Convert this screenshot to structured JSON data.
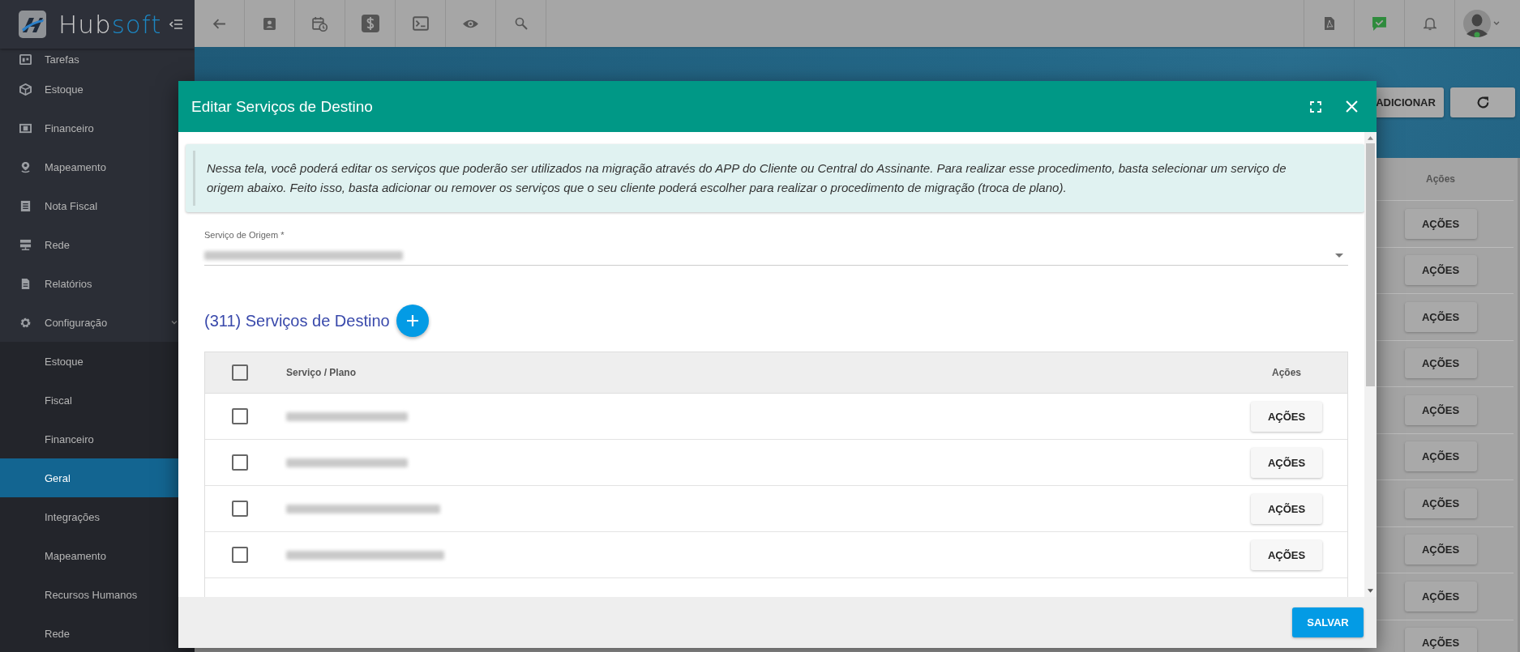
{
  "sidebar": {
    "brand": {
      "text": "Hub",
      "accent_text": "soft"
    },
    "items": [
      {
        "kind": "link",
        "label": "Tarefas",
        "selected": false
      },
      {
        "kind": "link",
        "label": "Estoque",
        "selected": false
      },
      {
        "kind": "link",
        "label": "Financeiro",
        "selected": false
      },
      {
        "kind": "link",
        "label": "Mapeamento",
        "selected": false
      },
      {
        "kind": "link",
        "label": "Nota Fiscal",
        "selected": false
      },
      {
        "kind": "link",
        "label": "Rede",
        "selected": false
      },
      {
        "kind": "link",
        "label": "Relatórios",
        "selected": false
      },
      {
        "kind": "group",
        "label": "Configuração",
        "selected": false,
        "expanded": true,
        "children": [
          {
            "label": "Estoque",
            "selected": false
          },
          {
            "label": "Fiscal",
            "selected": false
          },
          {
            "label": "Financeiro",
            "selected": false
          },
          {
            "label": "Geral",
            "selected": true
          },
          {
            "label": "Integrações",
            "selected": false
          },
          {
            "label": "Mapeamento",
            "selected": false
          },
          {
            "label": "Recursos Humanos",
            "selected": false
          },
          {
            "label": "Rede",
            "selected": false
          }
        ]
      }
    ]
  },
  "page": {
    "add_button": "ADICIONAR",
    "table": {
      "column": "Ações",
      "rows": [
        "AÇÕES",
        "AÇÕES",
        "AÇÕES",
        "AÇÕES",
        "AÇÕES",
        "AÇÕES",
        "AÇÕES",
        "AÇÕES",
        "AÇÕES",
        "AÇÕES"
      ]
    }
  },
  "modal": {
    "title": "Editar Serviços de Destino",
    "notice": "Nessa tela, você poderá editar os serviços que poderão ser utilizados na migração através do APP do Cliente ou Central do Assinante. Para realizar esse procedimento, basta selecionar um serviço de origem abaixo. Feito isso, basta adicionar ou remover os serviços que o seu cliente poderá escolher para realizar o procedimento de migração (troca de plano).",
    "origin_field": {
      "label": "Serviço de Origem *"
    },
    "destination": {
      "title": "(311) Serviços de Destino",
      "table": {
        "select_all": {
          "checked": false
        },
        "columns": [
          "Serviço / Plano",
          "Ações"
        ],
        "rows": [
          {
            "checked": false,
            "action": "AÇÕES"
          },
          {
            "checked": false,
            "action": "AÇÕES"
          },
          {
            "checked": false,
            "action": "AÇÕES"
          },
          {
            "checked": false,
            "action": "AÇÕES"
          }
        ]
      }
    },
    "save_button": "SALVAR"
  }
}
